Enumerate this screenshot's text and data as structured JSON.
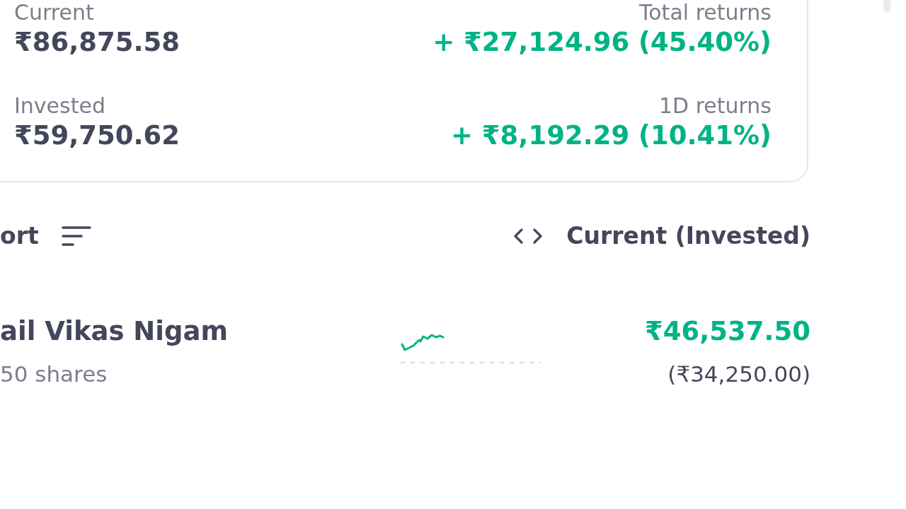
{
  "summary": {
    "current_label": "Current",
    "current_value": "₹86,875.58",
    "total_returns_label": "Total returns",
    "total_returns_value": "+ ₹27,124.96 (45.40%)",
    "invested_label": "Invested",
    "invested_value": "₹59,750.62",
    "day_returns_label": "1D returns",
    "day_returns_value": "+ ₹8,192.29 (10.41%)"
  },
  "toolbar": {
    "sort_label": "ort",
    "column_label": "Current (Invested)"
  },
  "holdings": [
    {
      "name": "ail Vikas Nigam",
      "shares": "50 shares",
      "current": "₹46,537.50",
      "invested": "(₹34,250.00)"
    }
  ]
}
